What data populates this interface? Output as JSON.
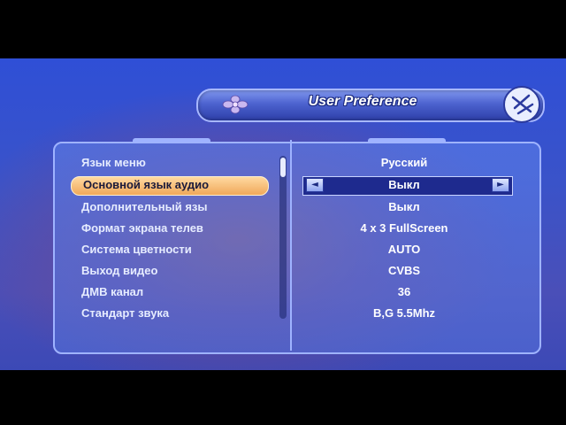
{
  "header": {
    "title": "User Preference",
    "decor_icon": "flower-ornament-icon",
    "corner_icon": "settings-badge-icon"
  },
  "menu": {
    "rows": [
      {
        "label": "Язык меню",
        "value": "Русский",
        "selected": false
      },
      {
        "label": "Основной язык аудио",
        "value": "Выкл",
        "selected": true
      },
      {
        "label": "Дополнительный язы",
        "value": "Выкл",
        "selected": false
      },
      {
        "label": "Формат экрана телев",
        "value": "4 x 3 FullScreen",
        "selected": false
      },
      {
        "label": "Система цветности",
        "value": "AUTO",
        "selected": false
      },
      {
        "label": "Выход видео",
        "value": "CVBS",
        "selected": false
      },
      {
        "label": "ДМВ канал",
        "value": "36",
        "selected": false
      },
      {
        "label": "Стандарт звука",
        "value": "B,G 5.5Mhz",
        "selected": false
      }
    ],
    "left_arrow": "◄",
    "right_arrow": "►"
  },
  "colors": {
    "highlight": "#f0a85a",
    "panel_border": "#9fb3ff",
    "background": "#2f4fd6"
  }
}
